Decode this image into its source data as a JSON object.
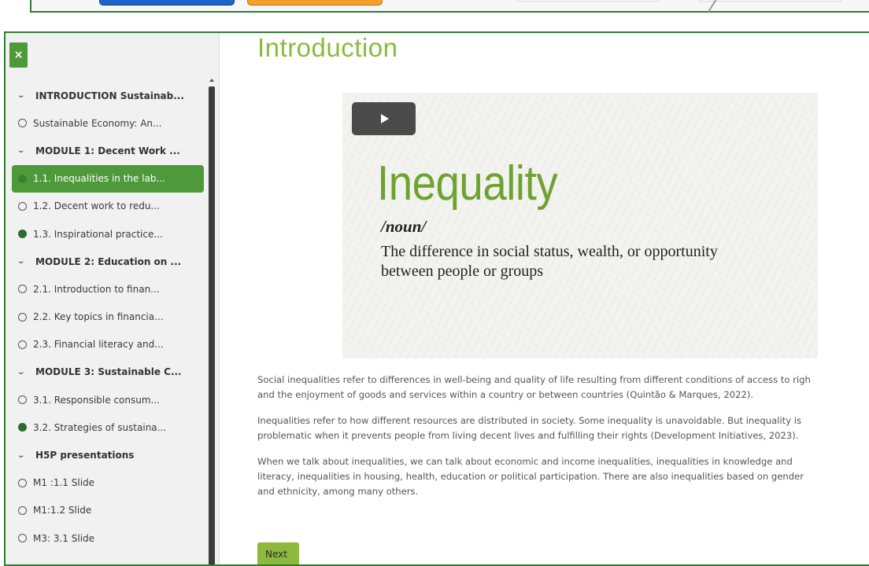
{
  "sidebar": {
    "close_label": "×",
    "items": [
      {
        "label": "INTRODUCTION Sustainab...",
        "type": "section"
      },
      {
        "label": "Sustainable Economy: An...",
        "type": "open"
      },
      {
        "label": "MODULE 1: Decent Work ...",
        "type": "section"
      },
      {
        "label": "1.1. Inequalities in the lab...",
        "type": "active"
      },
      {
        "label": "1.2. Decent work to redu...",
        "type": "open"
      },
      {
        "label": "1.3. Inspirational practice...",
        "type": "done"
      },
      {
        "label": "MODULE 2: Education on ...",
        "type": "section"
      },
      {
        "label": "2.1. Introduction to finan...",
        "type": "open"
      },
      {
        "label": "2.2. Key topics in financia...",
        "type": "open"
      },
      {
        "label": "2.3. Financial literacy and...",
        "type": "open"
      },
      {
        "label": "MODULE 3: Sustainable C...",
        "type": "section"
      },
      {
        "label": "3.1. Responsible consum...",
        "type": "open"
      },
      {
        "label": "3.2. Strategies of sustaina...",
        "type": "done"
      },
      {
        "label": "H5P presentations",
        "type": "section"
      },
      {
        "label": "M1 :1.1 Slide",
        "type": "open"
      },
      {
        "label": "M1:1.2 Slide",
        "type": "open"
      },
      {
        "label": "M3: 3.1 Slide",
        "type": "open"
      }
    ]
  },
  "content": {
    "title": "Introduction",
    "video": {
      "word": "Inequality",
      "part_of_speech": "/noun/",
      "definition": "The difference in social status, wealth, or opportunity between people or groups"
    },
    "paragraphs": [
      "Social inequalities refer to differences in well-being and quality of life resulting from different conditions of access to righ\nand the enjoyment of goods and services within a country or between countries (Quintão & Marques, 2022).",
      "Inequalities refer to how different resources are distributed in society. Some inequality is unavoidable. But inequality is\nproblematic when it prevents people from living decent lives and fulfilling their rights (Development Initiatives, 2023).",
      "When we talk about inequalities, we can talk about economic and income inequalities, inequalities in knowledge and\nliteracy, inequalities in housing, health, education or political participation. There are also inequalities based on gender\nand ethnicity, among many others."
    ],
    "next_label": "Next"
  },
  "colors": {
    "accent_green": "#4e9a3a",
    "title_green": "#8dba3c",
    "frame_green": "#2e7d32"
  }
}
